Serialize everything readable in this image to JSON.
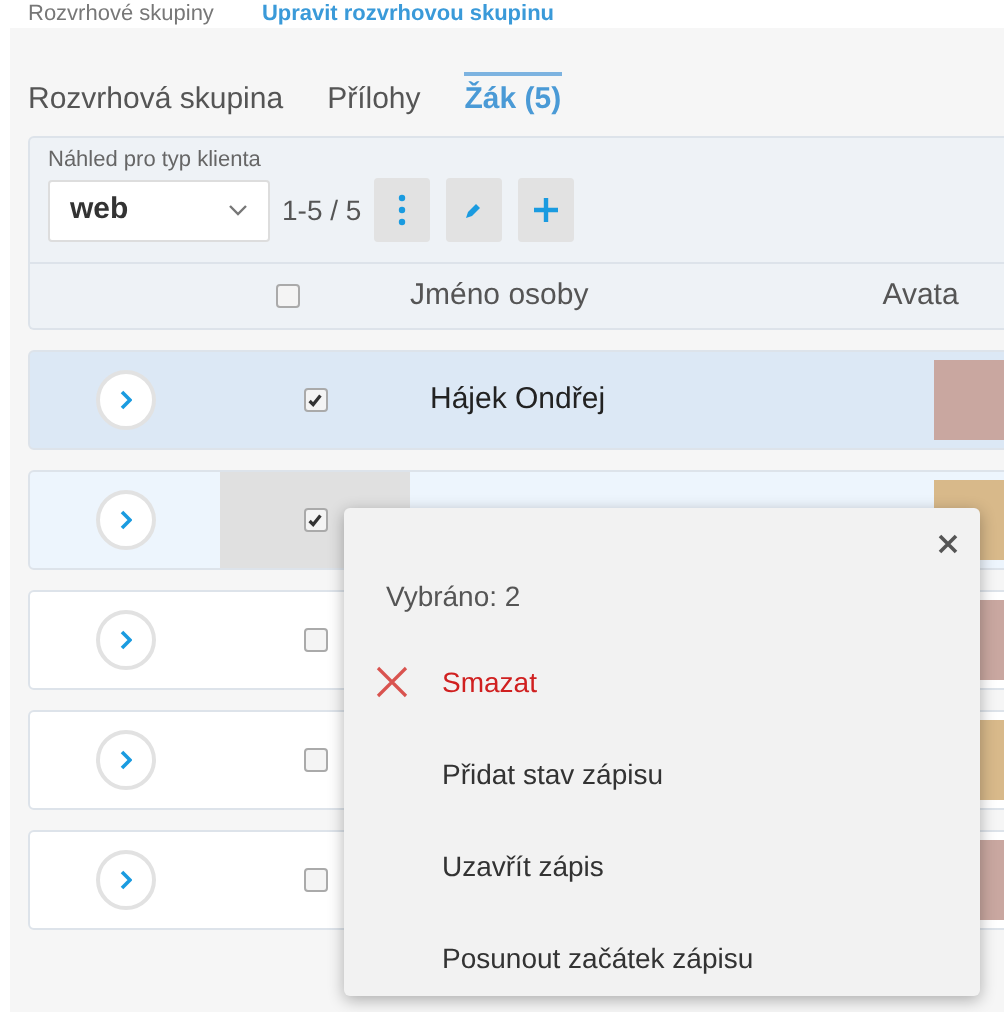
{
  "breadcrumb": [
    {
      "text": "Rozvrhové skupiny",
      "kind": "plain"
    },
    {
      "text": "Upravit rozvrhovou skupinu",
      "kind": "link"
    }
  ],
  "tabs": [
    {
      "label": "Rozvrhová skupina",
      "selected": false
    },
    {
      "label": "Přílohy",
      "selected": false
    },
    {
      "label": "Žák (5)",
      "selected": true
    }
  ],
  "toolbar": {
    "select_label": "Náhled pro typ klienta",
    "select_value": "web",
    "range": "1-5 / 5"
  },
  "table": {
    "header_checked": false,
    "columns": [
      "Jméno osoby",
      "Avata"
    ],
    "rows": [
      {
        "name": "Hájek Ondřej",
        "checked": true,
        "selected": true
      },
      {
        "checked": true,
        "selected": false
      },
      {
        "checked": false,
        "selected": false
      },
      {
        "checked": false,
        "selected": false
      },
      {
        "checked": false,
        "selected": false
      }
    ]
  },
  "menu": {
    "title": "Vybráno: 2",
    "items": [
      {
        "label": "Smazat",
        "kind": "danger"
      },
      {
        "label": "Přidat stav zápisu",
        "kind": "plain"
      },
      {
        "label": "Uzavřít zápis",
        "kind": "plain"
      },
      {
        "label": "Posunout začátek zápisu",
        "kind": "plain"
      }
    ]
  }
}
